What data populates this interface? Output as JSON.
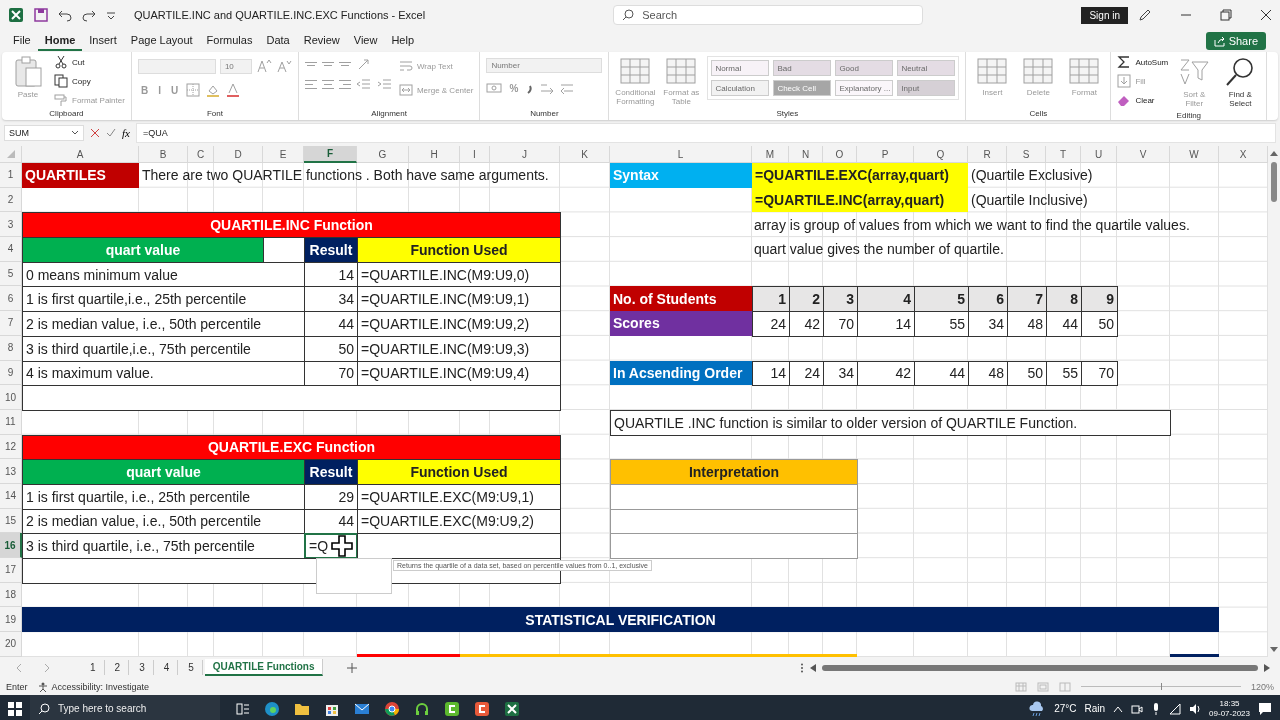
{
  "window": {
    "title": "QUARTILE.INC and QUARTILE.INC.EXC Functions  -  Excel",
    "search_placeholder": "Search",
    "sign_in": "Sign in"
  },
  "menu_tabs": [
    {
      "label": "File",
      "selected": false
    },
    {
      "label": "Home",
      "selected": true
    },
    {
      "label": "Insert",
      "selected": false
    },
    {
      "label": "Page Layout",
      "selected": false
    },
    {
      "label": "Formulas",
      "selected": false
    },
    {
      "label": "Data",
      "selected": false
    },
    {
      "label": "Review",
      "selected": false
    },
    {
      "label": "View",
      "selected": false
    },
    {
      "label": "Help",
      "selected": false
    }
  ],
  "share": "Share",
  "ribbon": {
    "groups": [
      {
        "label": "Clipboard",
        "items": [
          {
            "kind": "large",
            "label": "Paste",
            "disabled": true
          },
          {
            "kind": "small",
            "label": "Cut",
            "disabled": false
          },
          {
            "kind": "small",
            "label": "Copy",
            "disabled": false
          },
          {
            "kind": "small",
            "label": "Format Painter",
            "disabled": true
          }
        ]
      },
      {
        "label": "Font",
        "items": [
          {
            "kind": "field",
            "disabled": true
          },
          {
            "kind": "field",
            "value": "10",
            "disabled": true
          },
          {
            "kind": "tool",
            "label": "B",
            "disabled": true
          },
          {
            "kind": "tool",
            "label": "I",
            "disabled": true
          },
          {
            "kind": "tool",
            "label": "U",
            "disabled": true
          }
        ]
      },
      {
        "label": "Alignment",
        "items": [
          {
            "kind": "small",
            "label": "Wrap Text",
            "disabled": true
          },
          {
            "kind": "small",
            "label": "Merge & Center",
            "disabled": true
          }
        ]
      },
      {
        "label": "Number",
        "items": [
          {
            "kind": "field",
            "value": "Number",
            "disabled": true
          },
          {
            "kind": "tool",
            "label": "%",
            "disabled": true
          }
        ]
      },
      {
        "label": "Styles",
        "items": [
          {
            "kind": "large",
            "label": "Conditional Formatting",
            "disabled": true
          },
          {
            "kind": "large",
            "label": "Format as Table",
            "disabled": true
          }
        ],
        "gallery": [
          {
            "kind": "style",
            "label": "Normal",
            "color": "#f7f2f7"
          },
          {
            "kind": "style",
            "label": "Bad",
            "color": "#e4dce4"
          },
          {
            "kind": "style",
            "label": "Good",
            "color": "#e4dce4"
          },
          {
            "kind": "style",
            "label": "Neutral",
            "color": "#e4dce4"
          },
          {
            "kind": "style",
            "label": "Calculation",
            "color": "#f2f2f2"
          },
          {
            "kind": "style",
            "label": "Check Cell",
            "color": "#a6a6a6"
          },
          {
            "kind": "style",
            "label": "Explanatory ...",
            "color": "#faf6fa"
          },
          {
            "kind": "style",
            "label": "Input",
            "color": "#d6d0d6"
          }
        ]
      },
      {
        "label": "Cells",
        "items": [
          {
            "kind": "large",
            "label": "Insert",
            "disabled": true
          },
          {
            "kind": "large",
            "label": "Delete",
            "disabled": true
          },
          {
            "kind": "large",
            "label": "Format",
            "disabled": true
          }
        ]
      },
      {
        "label": "Editing",
        "items": [
          {
            "kind": "small",
            "label": "AutoSum",
            "disabled": false
          },
          {
            "kind": "small",
            "label": "Fill",
            "disabled": true
          },
          {
            "kind": "small",
            "label": "Clear",
            "disabled": false
          },
          {
            "kind": "large",
            "label": "Sort & Filter",
            "disabled": true
          },
          {
            "kind": "large",
            "label": "Find & Select",
            "disabled": false
          }
        ]
      }
    ]
  },
  "name_box": "SUM",
  "function_label": "fx",
  "formula": "=QUA",
  "columns": [
    {
      "label": "A",
      "selected": false
    },
    {
      "label": "B",
      "selected": false
    },
    {
      "label": "C",
      "selected": false
    },
    {
      "label": "D",
      "selected": false
    },
    {
      "label": "E",
      "selected": false
    },
    {
      "label": "F",
      "selected": true
    },
    {
      "label": "G",
      "selected": false
    },
    {
      "label": "H",
      "selected": false
    },
    {
      "label": "I",
      "selected": false
    },
    {
      "label": "J",
      "selected": false
    },
    {
      "label": "K",
      "selected": false
    },
    {
      "label": "L",
      "selected": false
    },
    {
      "label": "M",
      "selected": false
    },
    {
      "label": "N",
      "selected": false
    },
    {
      "label": "O",
      "selected": false
    },
    {
      "label": "P",
      "selected": false
    },
    {
      "label": "Q",
      "selected": false
    },
    {
      "label": "R",
      "selected": false
    },
    {
      "label": "S",
      "selected": false
    },
    {
      "label": "T",
      "selected": false
    },
    {
      "label": "U",
      "selected": false
    },
    {
      "label": "V",
      "selected": false
    },
    {
      "label": "W",
      "selected": false
    },
    {
      "label": "X",
      "selected": false
    }
  ],
  "row_numbers": [
    {
      "label": "1",
      "selected": false
    },
    {
      "label": "2",
      "selected": false
    },
    {
      "label": "3",
      "selected": false
    },
    {
      "label": "4",
      "selected": false
    },
    {
      "label": "5",
      "selected": false
    },
    {
      "label": "6",
      "selected": false
    },
    {
      "label": "7",
      "selected": false
    },
    {
      "label": "8",
      "selected": false
    },
    {
      "label": "9",
      "selected": false
    },
    {
      "label": "10",
      "selected": false
    },
    {
      "label": "11",
      "selected": false
    },
    {
      "label": "12",
      "selected": false
    },
    {
      "label": "13",
      "selected": false
    },
    {
      "label": "14",
      "selected": false
    },
    {
      "label": "15",
      "selected": false
    },
    {
      "label": "16",
      "selected": true
    },
    {
      "label": "17",
      "selected": false
    },
    {
      "label": "18",
      "selected": false
    },
    {
      "label": "19",
      "selected": false
    },
    {
      "label": "20",
      "selected": false
    }
  ],
  "sheet": {
    "title": "QUARTILES",
    "intro": "There are two QUARTILE functions . Both have same arguments.",
    "inc_table": {
      "title": "QUARTILE.INC Function",
      "headers": [
        "quart value",
        "Result",
        "Function Used"
      ],
      "rows": [
        {
          "quart_value": "0 means minimum value",
          "result": "14",
          "function": "=QUARTILE.INC(M9:U9,0)",
          "active": false
        },
        {
          "quart_value": "1 is first quartile,i.e., 25th percentile",
          "result": "34",
          "function": "=QUARTILE.INC(M9:U9,1)",
          "active": false
        },
        {
          "quart_value": "2 is median value, i.e., 50th percentile",
          "result": "44",
          "function": "=QUARTILE.INC(M9:U9,2)",
          "active": false
        },
        {
          "quart_value": "3 is third quartile,i.e., 75th percentile",
          "result": "50",
          "function": "=QUARTILE.INC(M9:U9,3)",
          "active": false
        },
        {
          "quart_value": "4 is maximum value.",
          "result": "70",
          "function": "=QUARTILE.INC(M9:U9,4)",
          "active": false
        }
      ]
    },
    "exc_table": {
      "title": "QUARTILE.EXC Function",
      "headers": [
        "quart value",
        "Result",
        "Function Used"
      ],
      "rows": [
        {
          "quart_value": "1 is first quartile, i.e., 25th percentile",
          "result": "29",
          "function": "=QUARTILE.EXC(M9:U9,1)",
          "active": false
        },
        {
          "quart_value": "2 is median value, i.e., 50th percentile",
          "result": "44",
          "function": "=QUARTILE.EXC(M9:U9,2)",
          "active": false
        },
        {
          "quart_value": "3 is third quartile, i.e., 75th percentile",
          "result": "=Q",
          "active": true
        }
      ]
    },
    "syntax": {
      "label": "Syntax",
      "formulas": [
        {
          "formula": "=QUARTILE.EXC(array,quart)",
          "note": "(Quartile Exclusive)"
        },
        {
          "formula": "=QUARTILE.INC(array,quart)",
          "note": "(Quartile Inclusive)"
        }
      ],
      "notes": [
        "array is group of values from which we want to find the quartile values.",
        "quart value gives the number of quartile."
      ]
    },
    "students": {
      "label": "No. of Students",
      "values": [
        "1",
        "2",
        "3",
        "4",
        "5",
        "6",
        "7",
        "8",
        "9"
      ]
    },
    "scores": {
      "label": "Scores",
      "values": [
        "24",
        "42",
        "70",
        "14",
        "55",
        "34",
        "48",
        "44",
        "50"
      ]
    },
    "ascending": {
      "label": "In Acsending Order",
      "values": [
        "14",
        "24",
        "34",
        "42",
        "44",
        "48",
        "50",
        "55",
        "70"
      ]
    },
    "remark": "QUARTILE .INC function is similar to older version of QUARTILE Function.",
    "interpretation": "Interpretation",
    "verification": "STATISTICAL VERIFICATION",
    "tooltip": "Returns the quartile of a data set, based on percentile values from 0..1, exclusive"
  },
  "sheet_tabs": [
    {
      "label": "1",
      "selected": false
    },
    {
      "label": "2",
      "selected": false
    },
    {
      "label": "3",
      "selected": false
    },
    {
      "label": "4",
      "selected": false
    },
    {
      "label": "5",
      "selected": false
    },
    {
      "label": "QUARTILE Functions",
      "selected": true
    }
  ],
  "status_bar": {
    "mode": "Enter",
    "accessibility": "Accessibility: Investigate",
    "zoom": {
      "level": 0.5,
      "reading": "120%"
    }
  },
  "taskbar": {
    "search_placeholder": "Type here to search",
    "temperature": "27°C",
    "weather": "Rain",
    "time": "18:35",
    "date": "09-07-2023"
  }
}
